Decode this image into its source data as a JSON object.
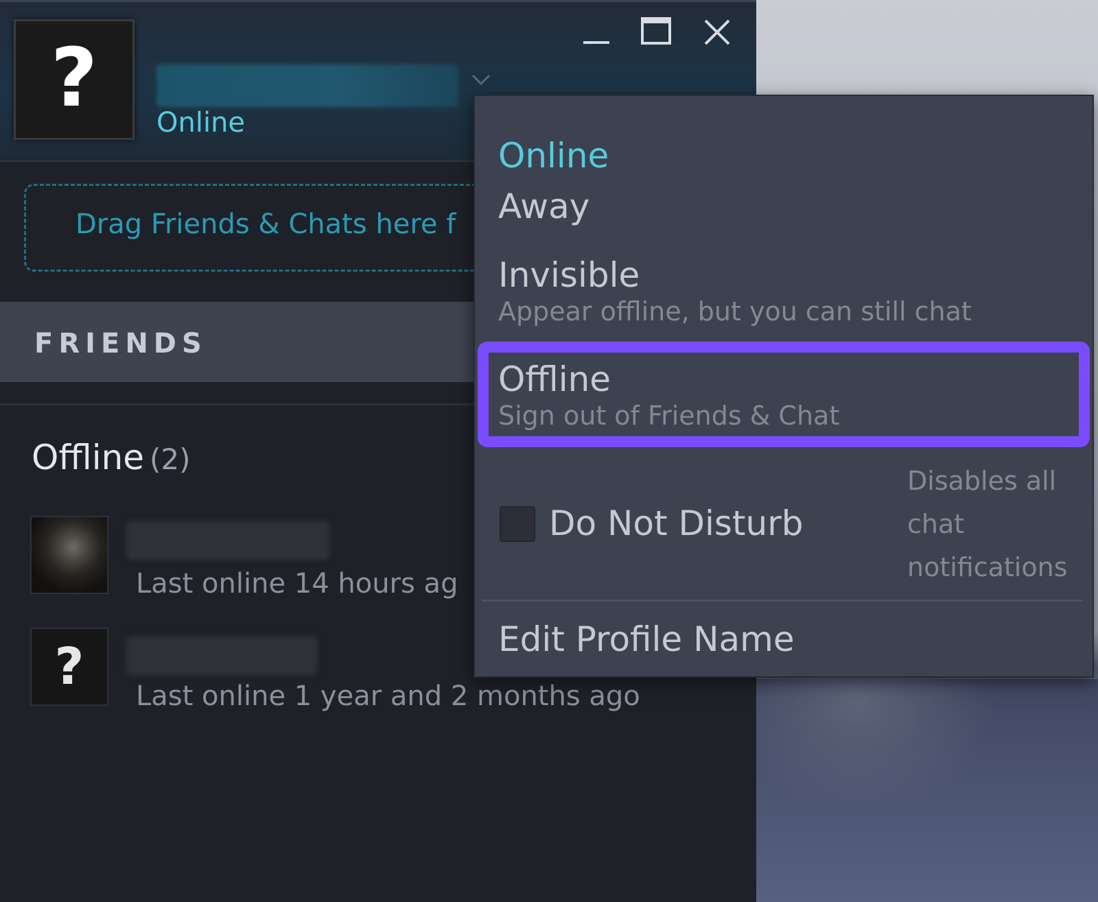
{
  "header": {
    "status": "Online",
    "icons": {
      "avatar": "question-mark-avatar",
      "chevron": "chevron-down-icon",
      "minimize": "minimize-icon",
      "maximize": "maximize-icon",
      "close": "close-icon"
    }
  },
  "drop_zone": {
    "text": "Drag Friends & Chats here f"
  },
  "friends_section": {
    "title": "FRIENDS"
  },
  "group": {
    "title": "Offline",
    "count": "(2)"
  },
  "friends": [
    {
      "status": "Last online 14 hours ag"
    },
    {
      "status": "Last online 1 year and 2 months ago"
    }
  ],
  "status_menu": {
    "items": [
      {
        "label": "Online",
        "sub": ""
      },
      {
        "label": "Away",
        "sub": ""
      },
      {
        "label": "Invisible",
        "sub": "Appear offline, but you can still chat"
      },
      {
        "label": "Offline",
        "sub": "Sign out of Friends & Chat"
      }
    ],
    "dnd": {
      "label": "Do Not Disturb",
      "description": "Disables all chat notifications",
      "checked": false
    },
    "edit_profile": "Edit Profile Name"
  },
  "colors": {
    "accent_cyan": "#57cbde",
    "highlight_purple": "#7b4cff",
    "menu_bg": "#3d4250",
    "window_bg": "#1e2128"
  }
}
